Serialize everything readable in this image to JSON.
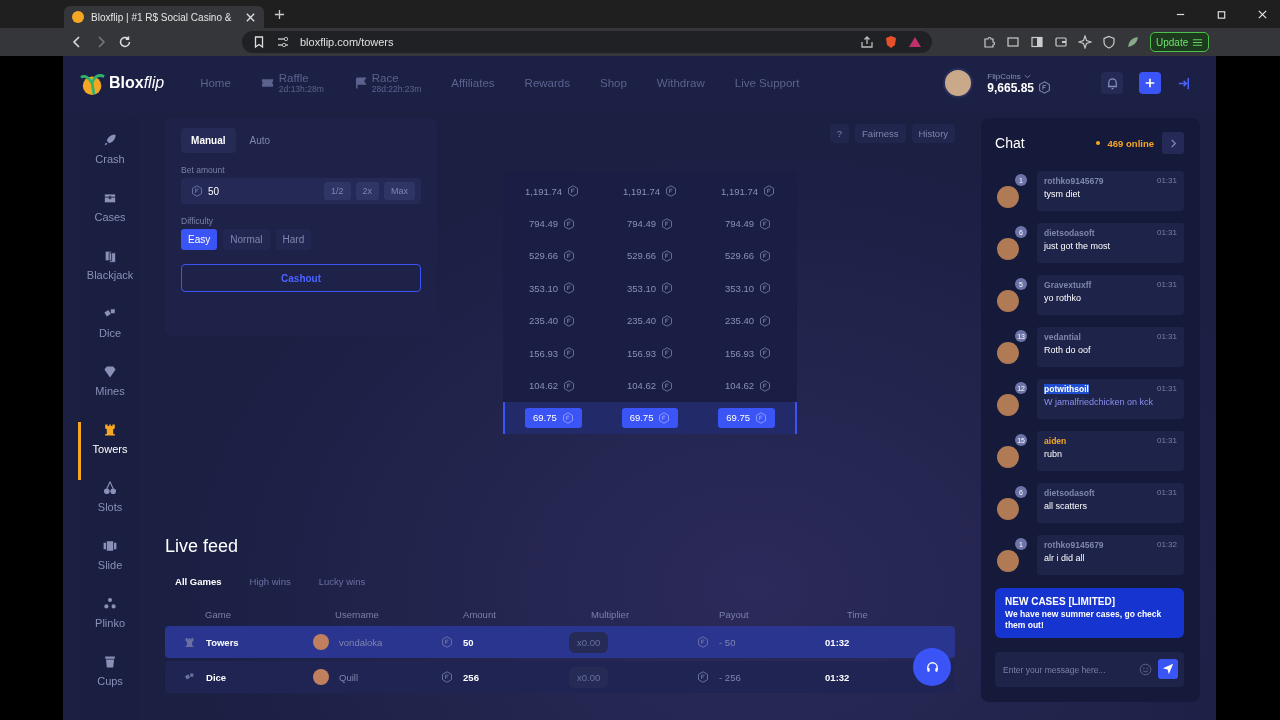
{
  "browser": {
    "tab_title": "Bloxflip | #1 R$ Social Casino &",
    "url": "bloxflip.com/towers",
    "update_label": "Update"
  },
  "header": {
    "logo": "**Blox**flip",
    "nav": [
      {
        "label": "Home",
        "kind": "plain"
      },
      {
        "label": "Raffle",
        "sub": "2d:13h:28m",
        "kind": "ticket"
      },
      {
        "label": "Race",
        "sub": "28d:22h:23m",
        "kind": "flag"
      },
      {
        "label": "Affiliates",
        "kind": "plain"
      },
      {
        "label": "Rewards",
        "kind": "plain"
      },
      {
        "label": "Shop",
        "kind": "plain"
      },
      {
        "label": "Withdraw",
        "kind": "plain"
      },
      {
        "label": "Live Support",
        "kind": "plain"
      }
    ],
    "balance_label": "FlipCoins",
    "balance": "9,665.85"
  },
  "sidebar": {
    "items": [
      {
        "label": "Crash",
        "kind": "rocket",
        "selected": false
      },
      {
        "label": "Cases",
        "kind": "chest",
        "selected": false
      },
      {
        "label": "Blackjack",
        "kind": "cards",
        "selected": false
      },
      {
        "label": "Dice",
        "kind": "dice",
        "selected": false
      },
      {
        "label": "Mines",
        "kind": "gem",
        "selected": false
      },
      {
        "label": "Towers",
        "kind": "tower",
        "selected": true
      },
      {
        "label": "Slots",
        "kind": "cherry",
        "selected": false
      },
      {
        "label": "Slide",
        "kind": "slide",
        "selected": false
      },
      {
        "label": "Plinko",
        "kind": "plinko",
        "selected": false
      },
      {
        "label": "Cups",
        "kind": "cup",
        "selected": false
      }
    ]
  },
  "bet_panel": {
    "modes": [
      {
        "label": "Manual",
        "selected": true
      },
      {
        "label": "Auto",
        "selected": false
      }
    ],
    "bet_label": "Bet amount",
    "bet_value": "50",
    "quick_buttons": [
      "1/2",
      "2x",
      "Max"
    ],
    "difficulty_label": "Difficulty",
    "difficulties": [
      {
        "label": "Easy",
        "selected": true
      },
      {
        "label": "Normal",
        "selected": false
      },
      {
        "label": "Hard",
        "selected": false
      }
    ],
    "cashout": "Cashout"
  },
  "game_buttons": [
    "?",
    "Fairness",
    "History"
  ],
  "tower": {
    "rows": [
      {
        "cells": [
          "1,191.74",
          "1,191.74",
          "1,191.74"
        ],
        "active": false
      },
      {
        "cells": [
          "794.49",
          "794.49",
          "794.49"
        ],
        "active": false
      },
      {
        "cells": [
          "529.66",
          "529.66",
          "529.66"
        ],
        "active": false
      },
      {
        "cells": [
          "353.10",
          "353.10",
          "353.10"
        ],
        "active": false
      },
      {
        "cells": [
          "235.40",
          "235.40",
          "235.40"
        ],
        "active": false
      },
      {
        "cells": [
          "156.93",
          "156.93",
          "156.93"
        ],
        "active": false
      },
      {
        "cells": [
          "104.62",
          "104.62",
          "104.62"
        ],
        "active": false
      },
      {
        "cells": [
          "69.75",
          "69.75",
          "69.75"
        ],
        "active": true
      }
    ]
  },
  "live_feed": {
    "title": "Live feed",
    "tabs": [
      {
        "label": "All Games",
        "selected": true
      },
      {
        "label": "High wins",
        "selected": false
      },
      {
        "label": "Lucky wins",
        "selected": false
      }
    ],
    "columns": [
      "Game",
      "Username",
      "Amount",
      "Multiplier",
      "Payout",
      "Time"
    ],
    "rows": [
      {
        "game": "Towers",
        "kind": "tower",
        "user": "vondaloka",
        "amount": "50",
        "multiplier": "x0.00",
        "payout": "- 50",
        "time": "01:32",
        "highlighted": true
      },
      {
        "game": "Dice",
        "kind": "dice",
        "user": "Quill",
        "amount": "256",
        "multiplier": "x0.00",
        "payout": "- 256",
        "time": "01:32",
        "highlighted": false
      }
    ]
  },
  "chat": {
    "title": "Chat",
    "online": "469 online",
    "messages": [
      {
        "user": "rothko9145679",
        "level": "1",
        "time": "01:31",
        "text": "tysm diet",
        "color": "#7f86ad",
        "highlighted": false
      },
      {
        "user": "dietsodasoft",
        "level": "6",
        "time": "01:31",
        "text": "just got the most",
        "color": "#7f86ad",
        "highlighted": false
      },
      {
        "user": "Gravextuxff",
        "level": "5",
        "time": "01:31",
        "text": "yo rothko",
        "color": "#7f86ad",
        "highlighted": false
      },
      {
        "user": "vedantial",
        "level": "13",
        "time": "01:31",
        "text": "Roth do oof",
        "color": "#7f86ad",
        "highlighted": false
      },
      {
        "user": "potwithsoil",
        "level": "12",
        "time": "01:31",
        "text": "W jamalfriedchicken on kck",
        "highlighted": true
      },
      {
        "user": "aiden",
        "level": "15",
        "time": "01:31",
        "text": "rubn",
        "color": "#f5a623",
        "highlighted": false
      },
      {
        "user": "dietsodasoft",
        "level": "6",
        "time": "01:31",
        "text": "all scatters",
        "color": "#7f86ad",
        "highlighted": false
      },
      {
        "user": "rothko9145679",
        "level": "1",
        "time": "01:32",
        "text": "alr i did all",
        "color": "#7f86ad",
        "highlighted": false
      }
    ],
    "banner_title": "NEW CASES [LIMITED]",
    "banner_text": "We have new summer cases, go check them out!",
    "input_placeholder": "Enter your message here..."
  }
}
